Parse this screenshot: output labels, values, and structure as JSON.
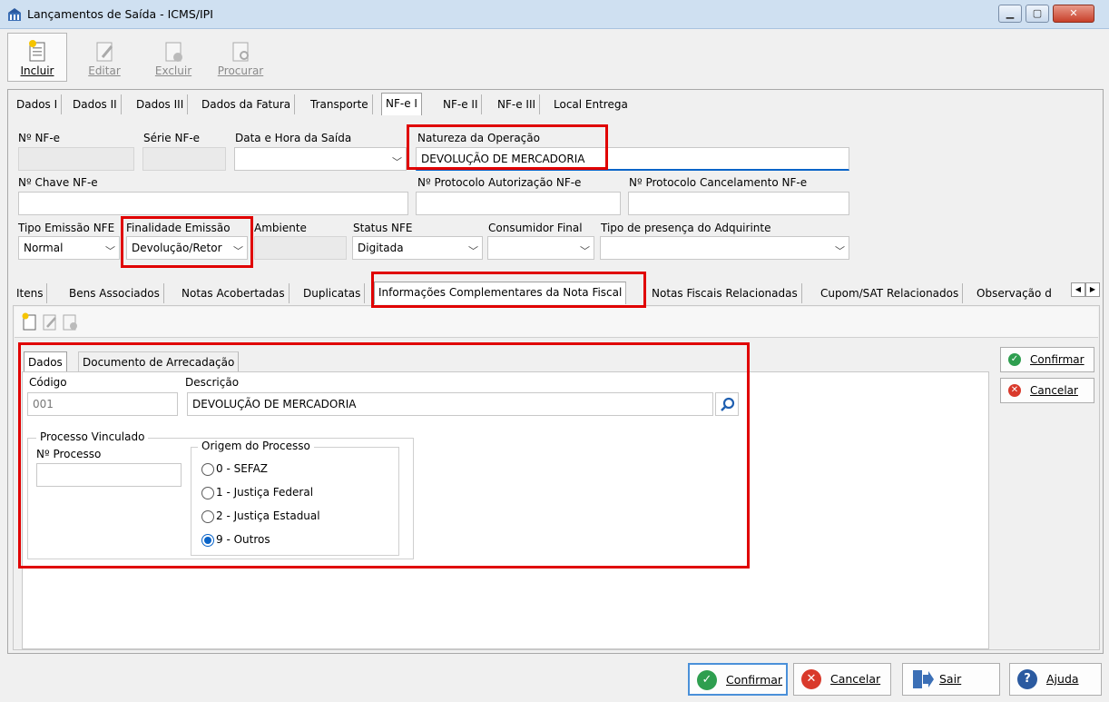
{
  "window": {
    "title": "Lançamentos de Saída - ICMS/IPI"
  },
  "toolbar": {
    "incluir": "Incluir",
    "editar": "Editar",
    "excluir": "Excluir",
    "procurar": "Procurar"
  },
  "tabs_top": [
    "Dados I",
    "Dados II",
    "Dados III",
    "Dados da Fatura",
    "Transporte",
    "NF-e I",
    "NF-e II",
    "NF-e III",
    "Local Entrega"
  ],
  "nfe": {
    "num_label": "Nº NF-e",
    "num_value": "",
    "serie_label": "Série NF-e",
    "serie_value": "",
    "data_saida_label": "Data e Hora da Saída",
    "data_saida_value": "",
    "natureza_label": "Natureza da Operação",
    "natureza_value": "DEVOLUÇÃO DE MERCADORIA",
    "chave_label": "Nº Chave NF-e",
    "chave_value": "",
    "prot_aut_label": "Nº Protocolo Autorização NF-e",
    "prot_aut_value": "",
    "prot_canc_label": "Nº Protocolo Cancelamento NF-e",
    "prot_canc_value": "",
    "tipo_emissao_label": "Tipo Emissão NFE",
    "tipo_emissao_value": "Normal",
    "finalidade_label": "Finalidade Emissão",
    "finalidade_value": "Devolução/Retor",
    "ambiente_label": "Ambiente",
    "ambiente_value": "",
    "status_label": "Status NFE",
    "status_value": "Digitada",
    "consumidor_label": "Consumidor Final",
    "consumidor_value": "",
    "presenca_label": "Tipo de presença do Adquirinte",
    "presenca_value": ""
  },
  "tabs_mid": [
    "Itens",
    "Bens Associados",
    "Notas Acobertadas",
    "Duplicatas",
    "Informações Complementares da Nota Fiscal",
    "Notas Fiscais Relacionadas",
    "Cupom/SAT Relacionados",
    "Observação d"
  ],
  "inner": {
    "tabs": [
      "Dados",
      "Documento de Arrecadação"
    ],
    "codigo_label": "Código",
    "codigo_value": "001",
    "descricao_label": "Descrição",
    "descricao_value": "DEVOLUÇÃO DE MERCADORIA",
    "processo_group": "Processo Vinculado",
    "num_processo_label": "Nº Processo",
    "num_processo_value": "",
    "origem_group": "Origem do Processo",
    "origens": [
      "0 - SEFAZ",
      "1 - Justiça Federal",
      "2 - Justiça Estadual",
      "9 - Outros"
    ],
    "origem_selected": "9 - Outros"
  },
  "side": {
    "confirmar": "Confirmar",
    "cancelar": "Cancelar"
  },
  "bottom": {
    "confirmar": "Confirmar",
    "cancelar": "Cancelar",
    "sair": "Sair",
    "ajuda": "Ajuda"
  },
  "colors": {
    "highlight": "#e00000",
    "accent": "#0a64c8",
    "confirm": "#2e9e4f",
    "cancel": "#d9392b"
  }
}
